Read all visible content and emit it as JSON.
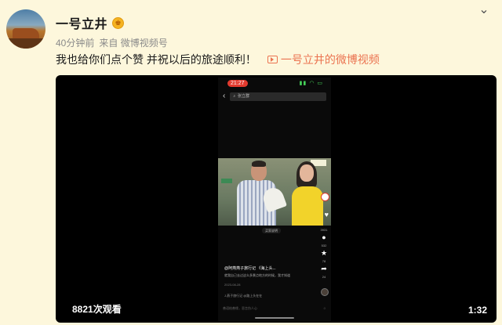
{
  "post": {
    "username": "一号立井",
    "badge_icon": "gold-vip-badge",
    "time": "40分钟前",
    "source": "来自 微博视频号",
    "text": "我也给你们点个赞 并祝以后的旅途顺利！",
    "video_link_label": "一号立井的微博视频",
    "more_icon": "chevron-down-icon",
    "accent_color": "#eb7350"
  },
  "video": {
    "views": "8821次观看",
    "duration": "1:32",
    "phone": {
      "time": "21:27",
      "search_text": "张立群",
      "caption_chip": "买家说明",
      "counts": {
        "comments": "532",
        "favorites": "78",
        "shares": "24",
        "likes": "3931"
      },
      "author": "@阿燕燕子旅行记",
      "title_suffix": "《海上头...",
      "description": "就我自己去过这么多景点地方的时候，我才知道",
      "date": "2023-08-28",
      "music": "J.燕子旅行记  @路上头在在",
      "comment_placeholder": "善语结善缘，恶言伤人心"
    }
  }
}
